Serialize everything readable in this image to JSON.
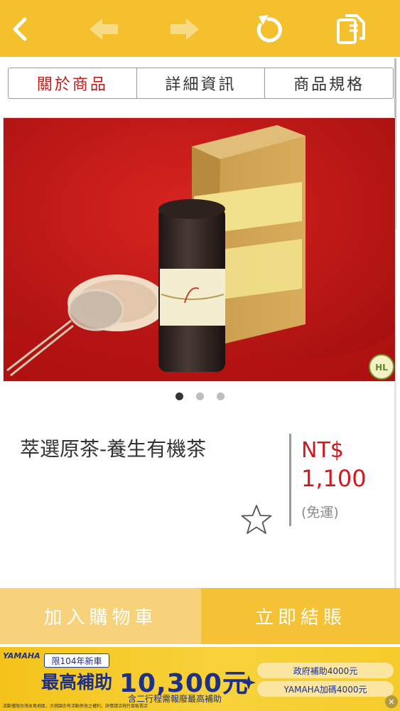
{
  "toolbar": {
    "back_icon": "chevron-left-icon",
    "prev_icon": "arrow-left-icon",
    "next_icon": "arrow-right-icon",
    "refresh_icon": "refresh-icon",
    "copy_icon": "copy-icon",
    "color": "#f5c02e"
  },
  "tabs": [
    {
      "label": "關於商品",
      "active": true
    },
    {
      "label": "詳細資訊",
      "active": false
    },
    {
      "label": "商品規格",
      "active": false
    }
  ],
  "carousel": {
    "count": 3,
    "active_index": 0,
    "logo_text": "HL"
  },
  "product": {
    "title": "萃選原茶-養生有機茶",
    "currency": "NT$",
    "price": "1,100",
    "shipping": "(免運)",
    "favorite_icon": "star-outline-icon",
    "price_color": "#d0191f"
  },
  "actions": {
    "add_to_cart": "加入購物車",
    "checkout": "立即結賬"
  },
  "ad": {
    "brand": "YAMAHA",
    "badge": "限104年新車",
    "headline": "最高補助",
    "amount": "10,300元",
    "subtext": "含二行程需報廢最高補助",
    "gov_subsidy": "政府補助4000元",
    "yamaha_subsidy": "YAMAHA加碼4000元",
    "fine_print": "活動僅限台灣本島地區，大桃園亦有活動參改之權利，詳情請洽桃竹苗販賣店"
  }
}
